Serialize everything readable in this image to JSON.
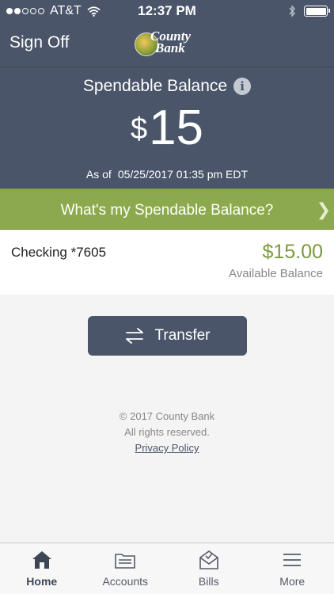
{
  "status_bar": {
    "carrier": "AT&T",
    "time": "12:37 PM"
  },
  "nav": {
    "sign_off": "Sign Off",
    "logo_line1": "County",
    "logo_line2": "Bank"
  },
  "balance": {
    "title": "Spendable Balance",
    "currency": "$",
    "amount": "15",
    "as_of_label": "As of",
    "timestamp": "05/25/2017 01:35 pm EDT"
  },
  "info_bar": {
    "label": "What's my Spendable Balance?"
  },
  "account": {
    "name": "Checking *7605",
    "amount": "$15.00",
    "sub": "Available Balance"
  },
  "transfer": {
    "label": "Transfer"
  },
  "footer": {
    "copyright": "© 2017 County Bank",
    "rights": "All rights reserved.",
    "privacy": "Privacy Policy"
  },
  "tabs": [
    {
      "label": "Home",
      "icon": "home-icon",
      "active": true
    },
    {
      "label": "Accounts",
      "icon": "folder-icon"
    },
    {
      "label": "Bills",
      "icon": "envelope-icon"
    },
    {
      "label": "More",
      "icon": "menu-icon"
    }
  ],
  "colors": {
    "header": "#4a5569",
    "accent_green": "#8caa4d",
    "amount_green": "#7a9a3a"
  }
}
